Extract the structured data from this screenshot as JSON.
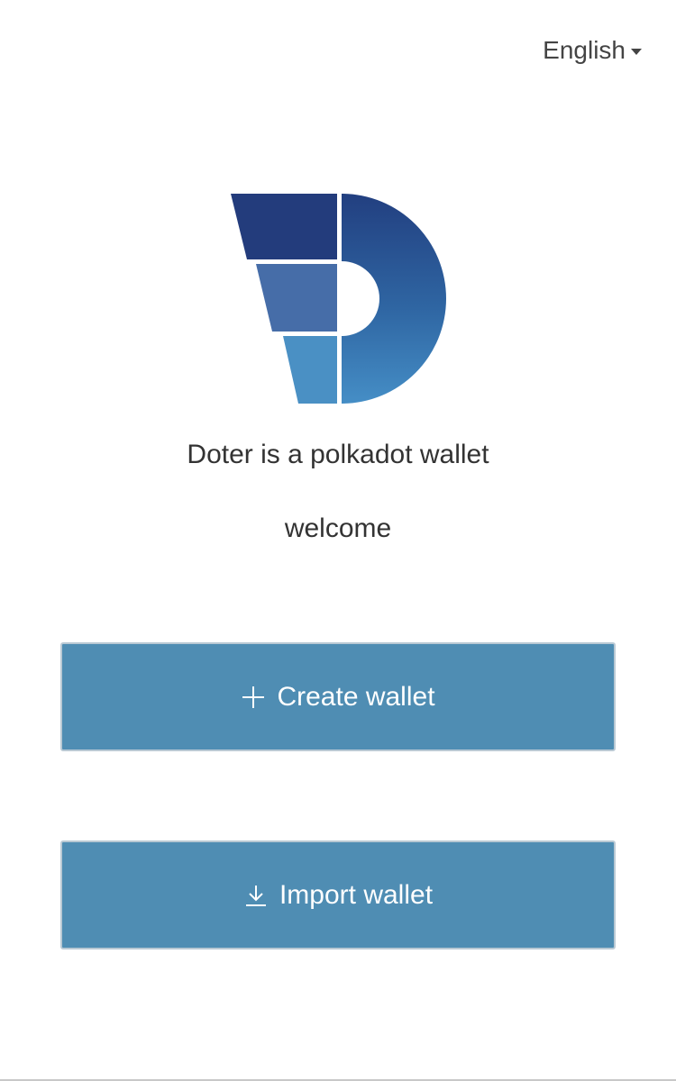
{
  "language": {
    "selected": "English",
    "icon": "caret-down-icon"
  },
  "logo": {
    "name": "doter-logo",
    "colors": [
      "#223a78",
      "#466ea8",
      "#4a90c4"
    ]
  },
  "intro": {
    "tagline": "Doter is a polkadot wallet",
    "welcome": "welcome"
  },
  "actions": {
    "create": {
      "label": "Create wallet",
      "icon": "plus-icon"
    },
    "import": {
      "label": "Import wallet",
      "icon": "download-icon"
    }
  },
  "colors": {
    "button_bg": "#4f8db3",
    "button_text": "#ffffff",
    "text": "#333333"
  }
}
